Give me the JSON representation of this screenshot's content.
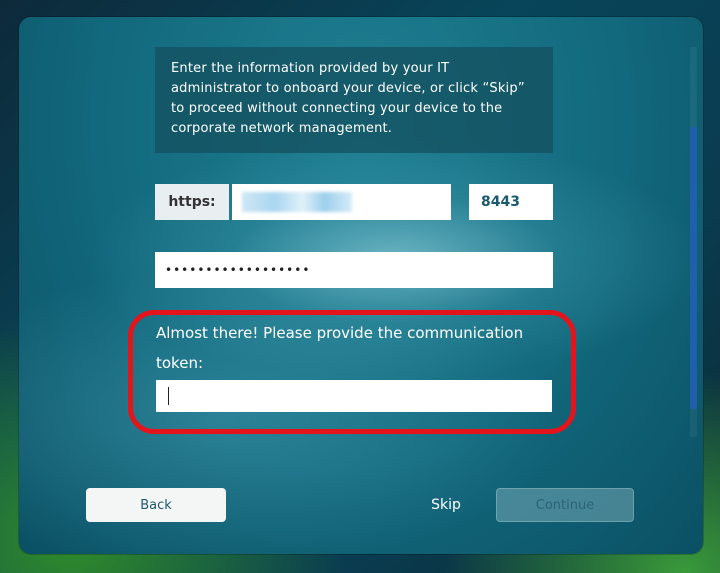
{
  "info": {
    "text": "Enter the information provided by your IT administrator to onboard your device, or click “Skip” to proceed without connecting your device to the corporate network management."
  },
  "server": {
    "protocol_label": "https:",
    "port_value": "8443"
  },
  "password": {
    "masked_value": "••••••••••••••••••"
  },
  "token": {
    "prompt": "Almost there! Please provide the communication token:",
    "value": ""
  },
  "buttons": {
    "back": "Back",
    "skip": "Skip",
    "continue": "Continue"
  },
  "colors": {
    "highlight_ring": "#e3141b",
    "scrollbar_thumb": "#1f5fae"
  }
}
